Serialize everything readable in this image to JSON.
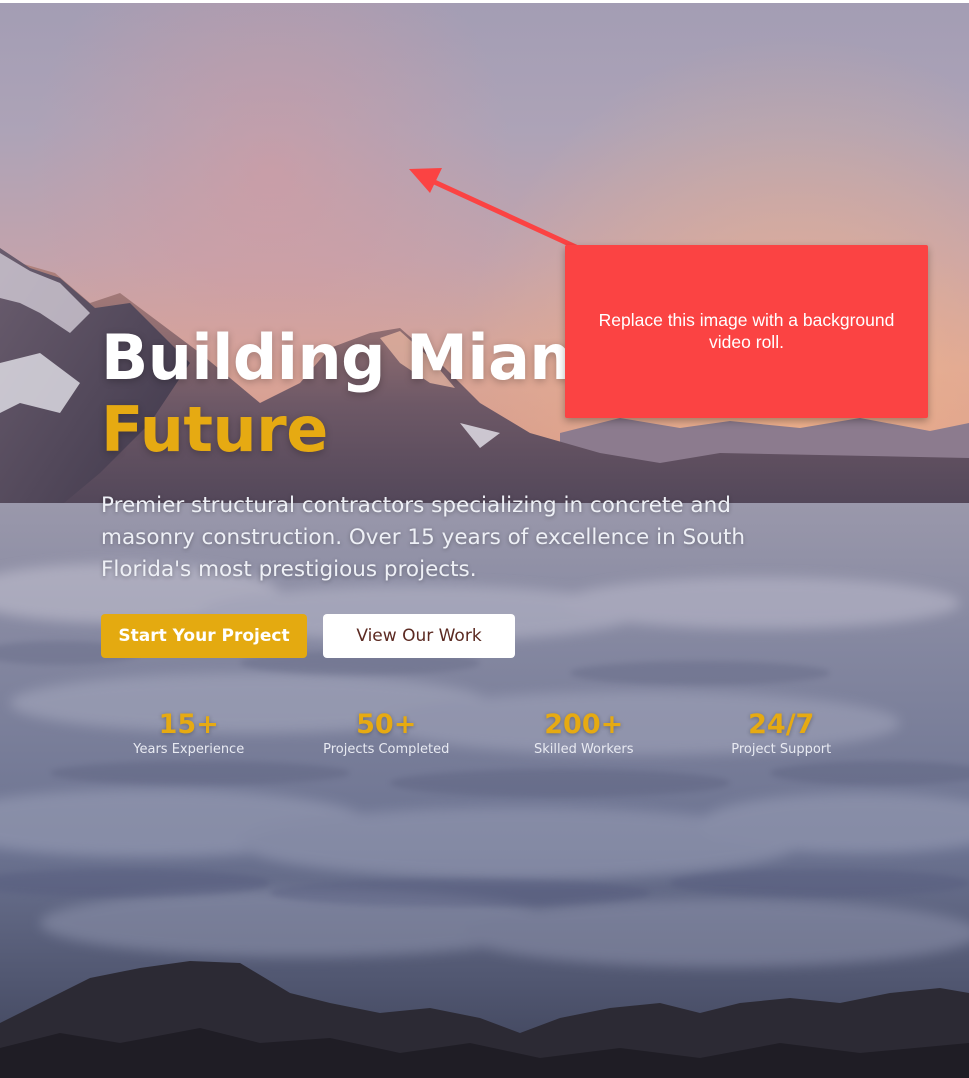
{
  "hero": {
    "title_line1": "Building Miami's",
    "title_line2": "Future",
    "description": "Premier structural contractors specializing in concrete and masonry construction. Over 15 years of excellence in South Florida's most prestigious projects.",
    "background": "mountain-sunset-clouds-image"
  },
  "buttons": {
    "primary_label": "Start Your Project",
    "secondary_label": "View Our Work"
  },
  "stats": [
    {
      "value": "15+",
      "label": "Years Experience"
    },
    {
      "value": "50+",
      "label": "Projects Completed"
    },
    {
      "value": "200+",
      "label": "Skilled Workers"
    },
    {
      "value": "24/7",
      "label": "Project Support"
    }
  ],
  "annotation": {
    "note": "Replace this image with a background video roll.",
    "icon": "arrow-icon"
  },
  "colors": {
    "accent": "#e6aa12",
    "primary_button": "#e4aa10",
    "secondary_button_text": "#5c2a22",
    "annotation": "#fb4343"
  }
}
